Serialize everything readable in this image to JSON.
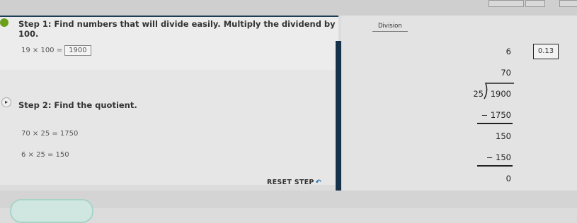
{
  "step1": {
    "title": "Step 1: Find numbers that will divide easily. Multiply the dividend by 100.",
    "equation": "19 × 100 =",
    "answer": "1900"
  },
  "step2": {
    "title": "Step 2: Find the quotient.",
    "lines": [
      "70 × 25 = 1750",
      "6 × 25 = 150"
    ]
  },
  "reset_label": "RESET STEP",
  "division": {
    "tab_label": "Division",
    "answer_box": "0.13",
    "quotient_top": "6",
    "quotient_mid": "70",
    "divisor": "25",
    "dividend": "1900",
    "sub1": "−  1750",
    "rem1": "150",
    "sub2": "−   150",
    "rem2": "0"
  }
}
